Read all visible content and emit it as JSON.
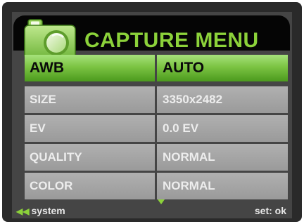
{
  "title": "CAPTURE MENU",
  "menu": [
    {
      "label": "AWB",
      "value": "AUTO",
      "selected": true
    },
    {
      "label": "SIZE",
      "value": "3350x2482",
      "selected": false
    },
    {
      "label": "EV",
      "value": "0.0 EV",
      "selected": false
    },
    {
      "label": "QUALITY",
      "value": "NORMAL",
      "selected": false
    },
    {
      "label": "COLOR",
      "value": "NORMAL",
      "selected": false
    }
  ],
  "footer": {
    "back_label": "system",
    "back_icon": "double-left-arrow-icon",
    "scroll_icon": "down-arrow-icon",
    "set_label": "set: ok"
  },
  "colors": {
    "accent_green": "#8cd23a",
    "selected_row": "#7cc443",
    "unselected_row": "#a6a6a6",
    "title_bar": "#050505"
  }
}
